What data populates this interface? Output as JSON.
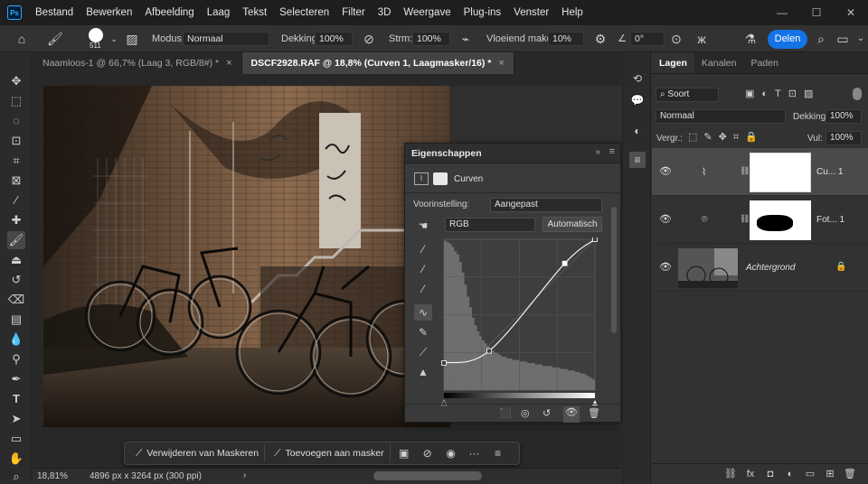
{
  "app": {
    "logo": "Ps",
    "menu": [
      "Bestand",
      "Bewerken",
      "Afbeelding",
      "Laag",
      "Tekst",
      "Selecteren",
      "Filter",
      "3D",
      "Weergave",
      "Plug-ins",
      "Venster",
      "Help"
    ],
    "window_controls": [
      "minimize-icon",
      "maximize-icon",
      "close-icon"
    ]
  },
  "options_bar": {
    "brush_size": "511",
    "mode_label": "Modus:",
    "mode_value": "Normaal",
    "opacity_label": "Dekking:",
    "opacity_value": "100%",
    "flow_label": "Strm:",
    "flow_value": "100%",
    "smoothing_label": "Vloeiend maken:",
    "smoothing_value": "10%",
    "angle_value": "0°",
    "share_label": "Delen"
  },
  "documents": {
    "tabs": [
      {
        "label": "Naamloos-1 @ 66,7% (Laag 3, RGB/8#) *",
        "active": false
      },
      {
        "label": "DSCF2928.RAF @ 18,8% (Curven 1, Laagmasker/16) *",
        "active": true
      }
    ],
    "close_glyph": "×"
  },
  "status": {
    "zoom": "18,81%",
    "doc_info": "4896 px x 3264 px (300 ppi)",
    "arrow": "›"
  },
  "taskbar": {
    "remove_masks": "Verwijderen van Maskeren",
    "add_to_mask": "Toevoegen aan masker",
    "more_glyph": "···"
  },
  "properties": {
    "title": "Eigenschappen",
    "adjustment": "Curven",
    "preset_label": "Voorinstelling:",
    "preset_value": "Aangepast",
    "channel_value": "RGB",
    "auto_button": "Automatisch",
    "curve_points": [
      [
        0,
        0.18
      ],
      [
        0.3,
        0.26
      ],
      [
        0.8,
        0.84
      ],
      [
        1,
        1
      ]
    ],
    "histogram": [
      0.99,
      0.98,
      0.97,
      0.95,
      0.92,
      0.9,
      0.85,
      0.78,
      0.7,
      0.62,
      0.55,
      0.48,
      0.43,
      0.39,
      0.36,
      0.33,
      0.31,
      0.29,
      0.27,
      0.26,
      0.25,
      0.24,
      0.23,
      0.22,
      0.22,
      0.21,
      0.21,
      0.2,
      0.2,
      0.2,
      0.19,
      0.19,
      0.19,
      0.18,
      0.18,
      0.18,
      0.17,
      0.17,
      0.17,
      0.16,
      0.16,
      0.16,
      0.16,
      0.15,
      0.15,
      0.15,
      0.14,
      0.14,
      0.14,
      0.13,
      0.13,
      0.13,
      0.12,
      0.12,
      0.11,
      0.11,
      0.1,
      0.09,
      0.08,
      0.07
    ]
  },
  "layers": {
    "tabs": [
      "Lagen",
      "Kanalen",
      "Paden"
    ],
    "kind_filter": "Soort",
    "blend_mode": "Normaal",
    "opacity_label": "Dekking:",
    "opacity_value": "100%",
    "lock_label": "Vergr.:",
    "fill_label": "Vul:",
    "fill_value": "100%",
    "items": [
      {
        "name": "Cu... 1",
        "type": "adjustment",
        "selected": true
      },
      {
        "name": "Fot... 1",
        "type": "smart",
        "selected": false
      },
      {
        "name": "Achtergrond",
        "type": "background",
        "selected": false
      }
    ]
  },
  "colors": {
    "accent": "#1473e6",
    "panel": "#323232",
    "menubar": "#1e1e1e"
  }
}
